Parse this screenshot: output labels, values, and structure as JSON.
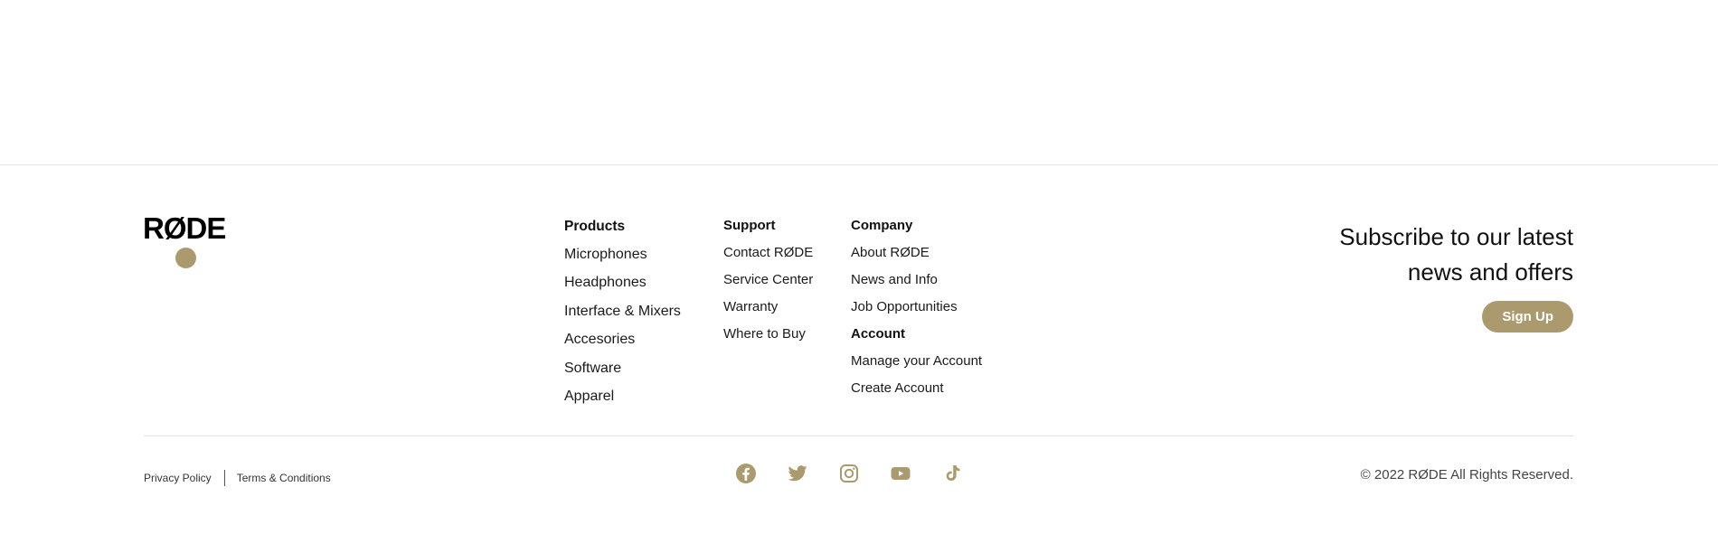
{
  "brand": {
    "logo_text": "RØDE",
    "accent_color": "#ab9a6d"
  },
  "footer": {
    "products": {
      "heading": "Products",
      "links": [
        "Microphones",
        "Headphones",
        "Interface & Mixers",
        "Accesories",
        "Software",
        "Apparel"
      ]
    },
    "support": {
      "heading": "Support",
      "links": [
        "Contact RØDE",
        "Service Center",
        "Warranty",
        "Where to Buy"
      ]
    },
    "company": {
      "heading": "Company",
      "links": [
        "About RØDE",
        "News and Info",
        "Job Opportunities"
      ]
    },
    "account": {
      "heading": "Account",
      "links": [
        "Manage your Account",
        "Create Account"
      ]
    },
    "subscribe": {
      "title": "Subscribe to our latest news and offers",
      "button_label": "Sign Up"
    },
    "legal": {
      "privacy": "Privacy Policy",
      "terms": "Terms & Conditions"
    },
    "social_icons": [
      "facebook-icon",
      "twitter-icon",
      "instagram-icon",
      "youtube-icon",
      "tiktok-icon"
    ],
    "copyright": "© 2022 RØDE All Rights Reserved."
  }
}
